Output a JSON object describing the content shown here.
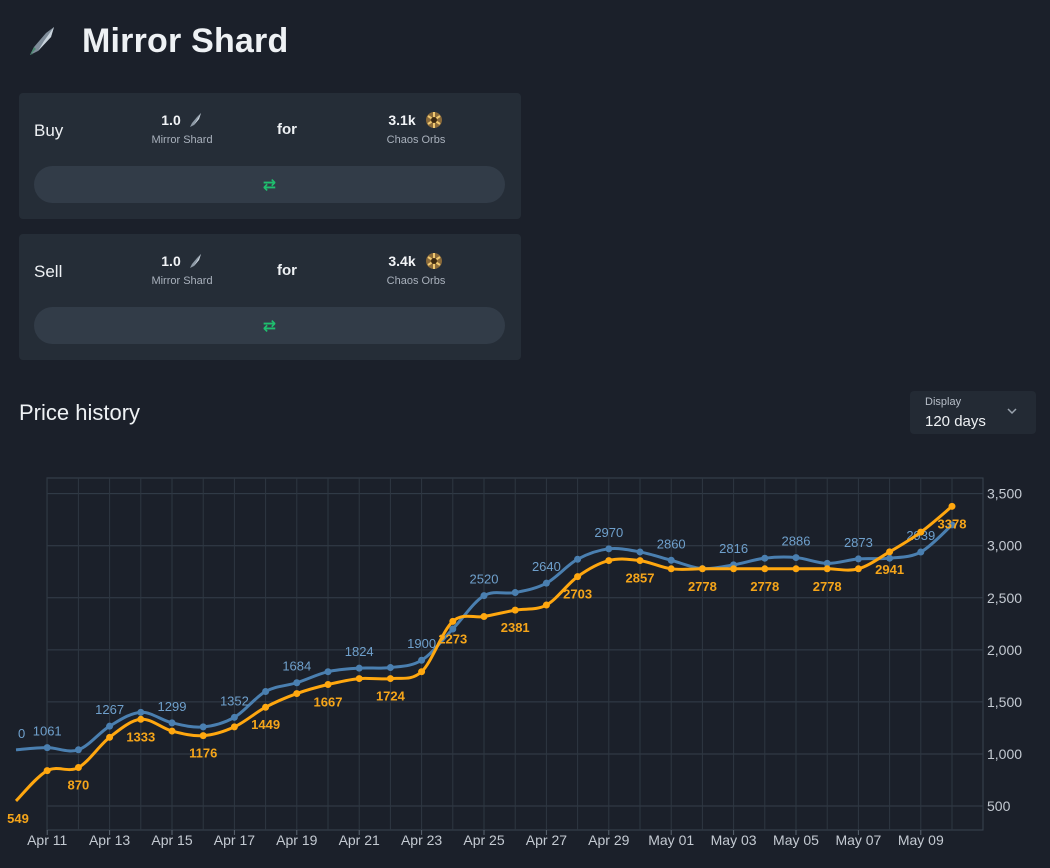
{
  "header": {
    "title": "Mirror Shard",
    "icon": "mirror-shard-icon"
  },
  "buy": {
    "label": "Buy",
    "give_amount": "1.0",
    "give_currency": "Mirror Shard",
    "for_label": "for",
    "get_amount": "3.1k",
    "get_currency": "Chaos Orbs",
    "swap_icon": "swap-arrows-icon"
  },
  "sell": {
    "label": "Sell",
    "give_amount": "1.0",
    "give_currency": "Mirror Shard",
    "for_label": "for",
    "get_amount": "3.4k",
    "get_currency": "Chaos Orbs",
    "swap_icon": "swap-arrows-icon"
  },
  "price_history": {
    "title": "Price history",
    "display": {
      "label": "Display",
      "value": "120 days",
      "icon": "chevron-down-icon"
    }
  },
  "colors": {
    "background": "#1b202a",
    "card": "#252d37",
    "blue_series": "#4a7fb0",
    "orange_series": "#ffa70f",
    "swap_icon": "#1fbf6e"
  },
  "chart_data": {
    "type": "line",
    "x": [
      "Apr 10",
      "Apr 11",
      "Apr 12",
      "Apr 13",
      "Apr 14",
      "Apr 15",
      "Apr 16",
      "Apr 17",
      "Apr 18",
      "Apr 19",
      "Apr 20",
      "Apr 21",
      "Apr 22",
      "Apr 23",
      "Apr 24",
      "Apr 25",
      "Apr 26",
      "Apr 27",
      "Apr 28",
      "Apr 29",
      "Apr 30",
      "May 01",
      "May 02",
      "May 03",
      "May 04",
      "May 05",
      "May 06",
      "May 07",
      "May 08",
      "May 09",
      "May 10"
    ],
    "x_tick_labels": [
      "Apr 11",
      "Apr 13",
      "Apr 15",
      "Apr 17",
      "Apr 19",
      "Apr 21",
      "Apr 23",
      "Apr 25",
      "Apr 27",
      "Apr 29",
      "May 01",
      "May 03",
      "May 05",
      "May 07",
      "May 09"
    ],
    "y_ticks": [
      500,
      1000,
      1500,
      2000,
      2500,
      3000,
      3500
    ],
    "y_tick_labels": [
      "500",
      "1,000",
      "1,500",
      "2,000",
      "2,500",
      "3,000",
      "3,500"
    ],
    "ylim": [
      270,
      3650
    ],
    "grid": true,
    "series": [
      {
        "color": "#4a7fb0",
        "values": [
          1040,
          1061,
          1040,
          1267,
          1400,
          1299,
          1260,
          1352,
          1600,
          1684,
          1790,
          1824,
          1830,
          1900,
          2200,
          2520,
          2550,
          2640,
          2870,
          2970,
          2940,
          2860,
          2780,
          2816,
          2880,
          2886,
          2830,
          2873,
          2880,
          2939,
          3200
        ],
        "labels": [
          "0",
          "1061",
          "1267",
          "1299",
          "1352",
          "1684",
          "1824",
          "1900",
          "2520",
          "2640",
          "2970",
          "2860",
          "2816",
          "2886",
          "2873",
          "2939"
        ],
        "label_indices": [
          0,
          1,
          3,
          5,
          7,
          9,
          11,
          13,
          15,
          17,
          19,
          21,
          23,
          25,
          27,
          29
        ]
      },
      {
        "color": "#ffa70f",
        "values": [
          549,
          840,
          870,
          1160,
          1333,
          1220,
          1176,
          1260,
          1449,
          1580,
          1667,
          1724,
          1724,
          1790,
          2273,
          2320,
          2381,
          2430,
          2703,
          2857,
          2857,
          2778,
          2778,
          2778,
          2778,
          2778,
          2778,
          2778,
          2941,
          3130,
          3378
        ],
        "labels": [
          "549",
          "870",
          "1333",
          "1176",
          "1449",
          "1667",
          "1724",
          "2273",
          "2381",
          "2703",
          "2857",
          "2778",
          "2778",
          "2778",
          "2941",
          "3378"
        ],
        "label_indices": [
          0,
          2,
          4,
          6,
          8,
          10,
          12,
          14,
          16,
          18,
          20,
          22,
          24,
          26,
          28,
          30
        ]
      }
    ]
  }
}
